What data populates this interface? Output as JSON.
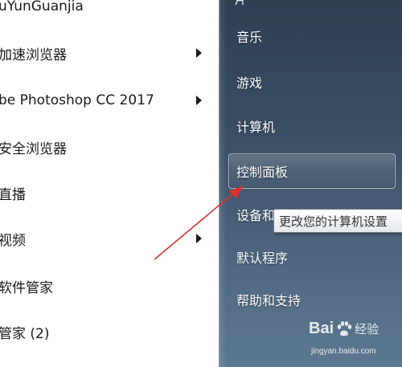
{
  "programs": [
    {
      "label": "uYunGuanjia",
      "has_submenu": false
    },
    {
      "label": "加速浏览器",
      "has_submenu": true
    },
    {
      "label": "be Photoshop CC 2017",
      "has_submenu": true
    },
    {
      "label": "安全浏览器",
      "has_submenu": false
    },
    {
      "label": "直播",
      "has_submenu": false
    },
    {
      "label": "视频",
      "has_submenu": true
    },
    {
      "label": "软件管家",
      "has_submenu": false
    },
    {
      "label": "管家 (2)",
      "has_submenu": false
    }
  ],
  "right_menu": {
    "top_partial": "片",
    "items": [
      {
        "label": "音乐"
      },
      {
        "label": "游戏"
      },
      {
        "label": "计算机"
      },
      {
        "label": "控制面板",
        "highlighted": true
      },
      {
        "label": "设备和打印机"
      },
      {
        "label": "默认程序"
      },
      {
        "label": "帮助和支持"
      }
    ]
  },
  "tooltip": {
    "text": "更改您的计算机设置"
  },
  "watermark": {
    "brand": "Bai",
    "brand_suffix": "经验",
    "url": "jingyan.baidu.com"
  },
  "colors": {
    "annotation_arrow": "#e0302a",
    "right_pane": "#3a4d64"
  }
}
